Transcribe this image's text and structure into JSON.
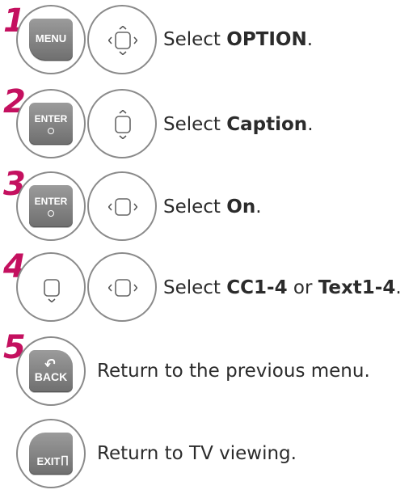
{
  "steps": [
    {
      "number": "1",
      "button": "MENU",
      "pre": "Select ",
      "bold1": "OPTION",
      "mid": "",
      "bold2": "",
      "post": "."
    },
    {
      "number": "2",
      "button": "ENTER",
      "pre": "Select ",
      "bold1": "Caption",
      "mid": "",
      "bold2": "",
      "post": "."
    },
    {
      "number": "3",
      "button": "ENTER",
      "pre": "Select ",
      "bold1": "On",
      "mid": "",
      "bold2": "",
      "post": "."
    },
    {
      "number": "4",
      "pre": "Select ",
      "bold1": "CC1-4",
      "mid": " or ",
      "bold2": "Text1-4",
      "post": "."
    },
    {
      "number": "5",
      "button": "BACK",
      "text": "Return to the previous menu."
    },
    {
      "button": "EXIT",
      "text": "Return to TV viewing."
    }
  ],
  "colors": {
    "step_number": "#c4105f",
    "button": "#808080",
    "outline": "#8a8a8a"
  }
}
